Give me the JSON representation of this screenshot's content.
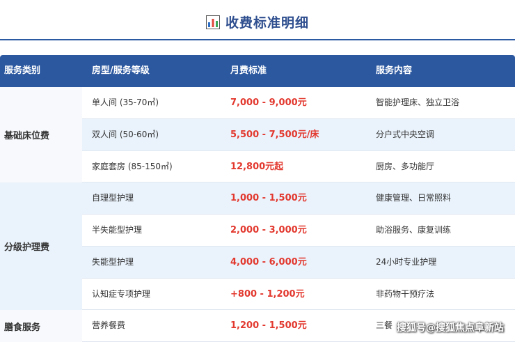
{
  "header": {
    "title": "收费标准明细",
    "icon": "bar-chart-icon"
  },
  "table": {
    "columns": [
      "服务类别",
      "房型/服务等级",
      "月费标准",
      "服务内容"
    ],
    "groups": [
      {
        "category": "基础床位费",
        "rows": [
          {
            "level": "单人间 (35-70㎡)",
            "price": "7,000 - 9,000元",
            "content": "智能护理床、独立卫浴"
          },
          {
            "level": "双人间 (50-60㎡)",
            "price": "5,500 - 7,500元/床",
            "content": "分户式中央空调"
          },
          {
            "level": "家庭套房 (85-150㎡)",
            "price": "12,800元起",
            "content": "厨房、多功能厅"
          }
        ]
      },
      {
        "category": "分级护理费",
        "rows": [
          {
            "level": "自理型护理",
            "price": "1,000 - 1,500元",
            "content": "健康管理、日常照料"
          },
          {
            "level": "半失能型护理",
            "price": "2,000 - 3,000元",
            "content": "助浴服务、康复训练"
          },
          {
            "level": "失能型护理",
            "price": "4,000 - 6,000元",
            "content": "24小时专业护理"
          },
          {
            "level": "认知症专项护理",
            "price": "+800 - 1,200元",
            "content": "非药物干预疗法"
          }
        ]
      },
      {
        "category": "膳食服务",
        "rows": [
          {
            "level": "营养餐费",
            "price": "1,200 - 1,500元",
            "content": "三餐"
          }
        ]
      }
    ]
  },
  "watermark": "搜狐号@搜狐焦点阜新站",
  "colors": {
    "header_bg": "#2c58a0",
    "title_text": "#2f4f8f",
    "price_text": "#e2382e",
    "row_alt_bg": "#eaf3fc"
  }
}
